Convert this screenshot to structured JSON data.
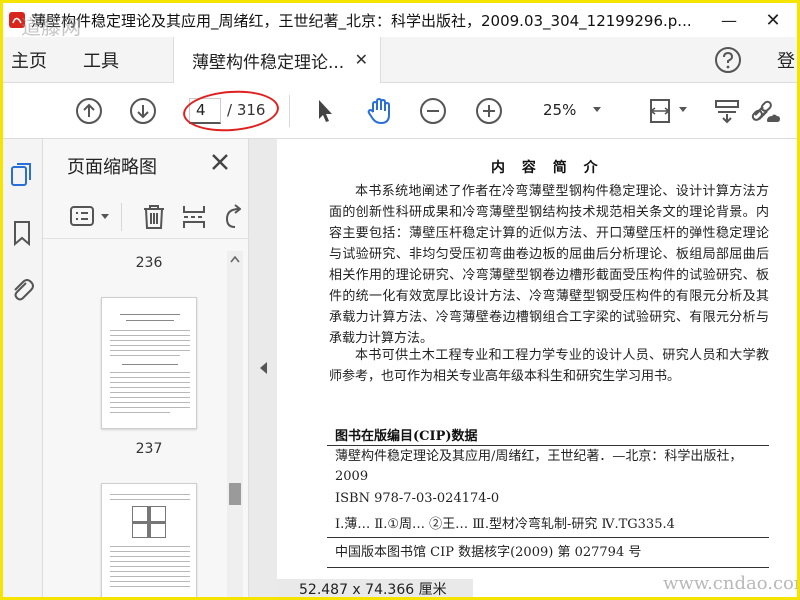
{
  "window": {
    "title": "薄壁构件稳定理论及其应用_周绪红，王世纪著_北京：科学出版社，2009.03_304_12199296.p...",
    "minimize": "—",
    "close": "✕"
  },
  "menu": {
    "home": "主页",
    "tools": "工具",
    "tab_label": "薄壁构件稳定理论...",
    "tab_close": "✕",
    "login": "登"
  },
  "toolbar": {
    "page_current": "4",
    "page_total": "/ 316",
    "zoom": "25%"
  },
  "thumbnails": {
    "title": "页面缩略图",
    "pages": [
      "236",
      "237"
    ]
  },
  "document": {
    "heading": "内 容 简 介",
    "intro_1": "本书系统地阐述了作者在冷弯薄壁型钢构件稳定理论、设计计算方法方面的创新性科研成果和冷弯薄壁型钢结构技术规范相关条文的理论背景。内容主要包括：薄壁压杆稳定计算的近似方法、开口薄壁压杆的弹性稳定理论与试验研究、非均匀受压初弯曲卷边板的屈曲后分析理论、板组局部屈曲后相关作用的理论研究、冷弯薄壁型钢卷边槽形截面受压构件的试验研究、板件的统一化有效宽厚比设计方法、冷弯薄壁型钢受压构件的有限元分析及其承载力计算方法、冷弯薄壁卷边槽钢组合工字梁的试验研究、有限元分析与承载力计算方法。",
    "intro_2": "本书可供土木工程专业和工程力学专业的设计人员、研究人员和大学教师参考，也可作为相关专业高年级本科生和研究生学习用书。",
    "cip_title": "图书在版编目(CIP)数据",
    "cip_book": "薄壁构件稳定理论及其应用/周绪红，王世纪著．—北京：科学出版社，2009",
    "isbn": "ISBN 978-7-03-024174-0",
    "classification": "Ⅰ.薄… Ⅱ.①周… ②王… Ⅲ.型材冷弯轧制-研究 Ⅳ.TG335.4",
    "cip_record": "中国版本图书馆 CIP 数据核字(2009) 第 027794 号"
  },
  "status": {
    "dimensions": "52.487 x 74.366 厘米"
  },
  "watermark": {
    "site": "www.cndao.com",
    "top": "道藤网"
  },
  "colors": {
    "frame": "#f5e400",
    "accent_blue": "#2a6fd6",
    "annotation_red": "#e02020"
  }
}
